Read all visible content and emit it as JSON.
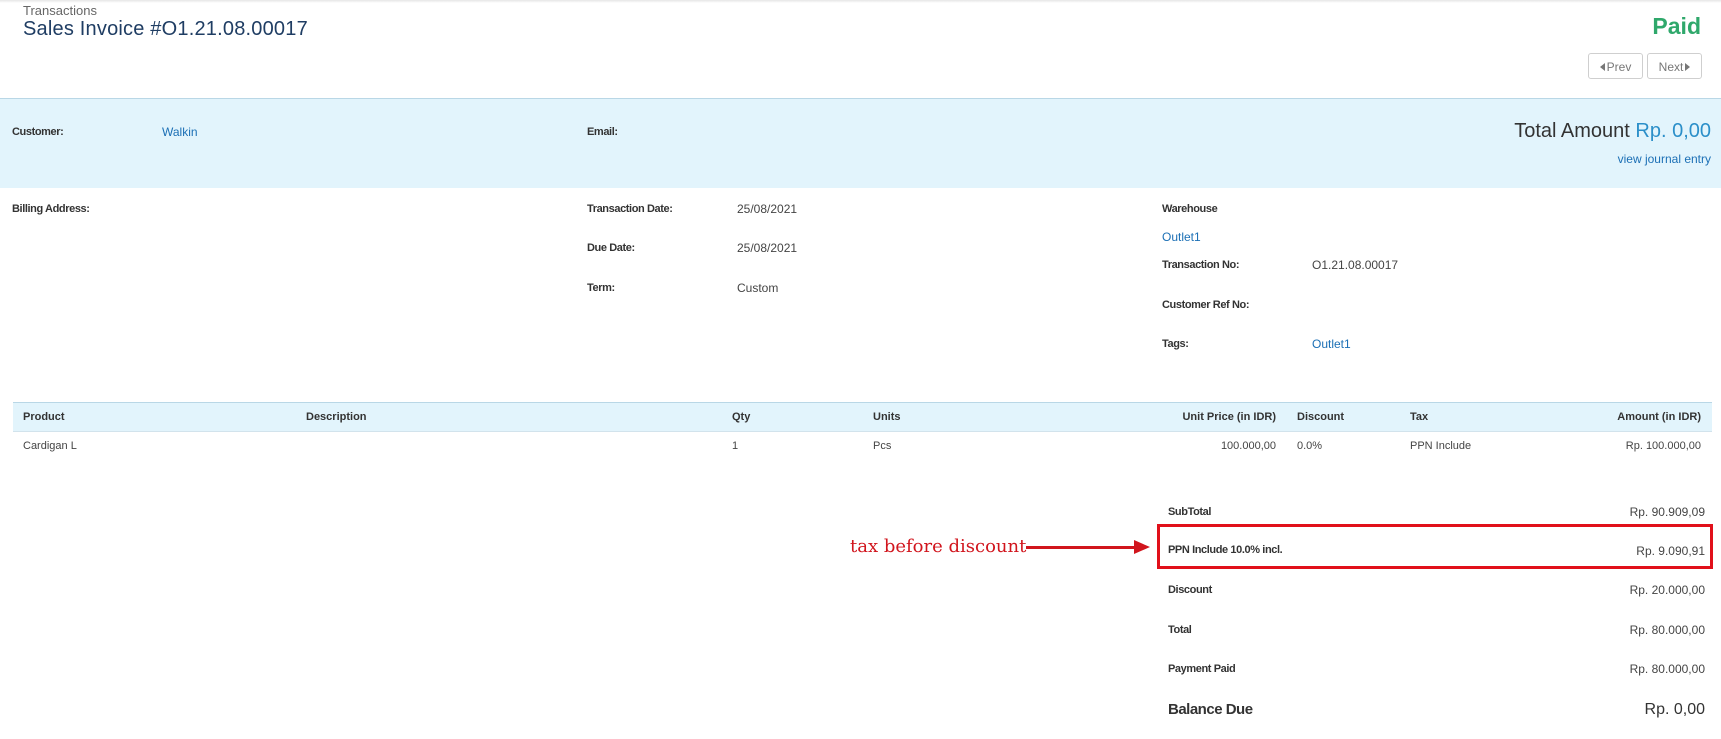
{
  "header": {
    "breadcrumb": "Transactions",
    "title": "Sales Invoice #O1.21.08.00017",
    "status": "Paid",
    "prev_label": "Prev",
    "next_label": "Next"
  },
  "summary_band": {
    "customer_label": "Customer:",
    "customer_value": "Walkin",
    "email_label": "Email:",
    "email_value": "",
    "total_amount_label": "Total Amount",
    "total_amount_value": "Rp. 0,00",
    "journal_link": "view journal entry"
  },
  "details": {
    "billing_address_label": "Billing Address:",
    "transaction_date_label": "Transaction Date:",
    "transaction_date": "25/08/2021",
    "due_date_label": "Due Date:",
    "due_date": "25/08/2021",
    "term_label": "Term:",
    "term": "Custom",
    "warehouse_label": "Warehouse",
    "warehouse": "Outlet1",
    "transaction_no_label": "Transaction No:",
    "transaction_no": "O1.21.08.00017",
    "customer_ref_label": "Customer Ref No:",
    "tags_label": "Tags:",
    "tags": "Outlet1"
  },
  "items_table": {
    "columns": [
      "Product",
      "Description",
      "Qty",
      "Units",
      "Unit Price (in IDR)",
      "Discount",
      "Tax",
      "Amount (in IDR)"
    ],
    "rows": [
      {
        "product": "Cardigan L",
        "description": "",
        "qty": "1",
        "units": "Pcs",
        "unit_price": "100.000,00",
        "discount": "0.0%",
        "tax": "PPN Include",
        "amount": "Rp. 100.000,00"
      }
    ]
  },
  "totals": {
    "subtotal_label": "SubTotal",
    "subtotal": "Rp. 90.909,09",
    "tax_label": "PPN Include 10.0% incl.",
    "tax": "Rp. 9.090,91",
    "discount_label": "Discount",
    "discount": "Rp. 20.000,00",
    "total_label": "Total",
    "total": "Rp. 80.000,00",
    "payment_paid_label": "Payment Paid",
    "payment_paid": "Rp. 80.000,00",
    "balance_due_label": "Balance Due",
    "balance_due": "Rp. 0,00"
  },
  "annotation": {
    "text": "tax before discount",
    "color": "#d1151d"
  },
  "colors": {
    "accent_blue": "#1b6fb5",
    "paid_green": "#2fa86b",
    "band_background": "#e2f4fc",
    "title_navy": "#1f3d63"
  }
}
